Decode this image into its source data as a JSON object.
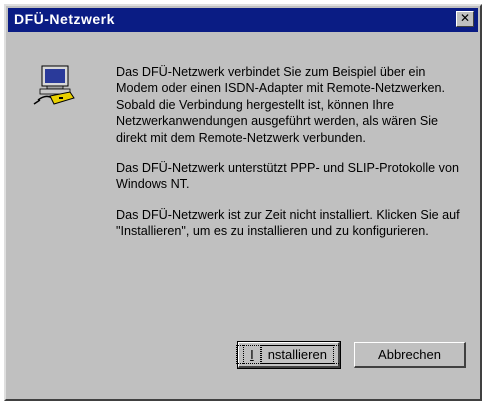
{
  "window": {
    "title": "DFÜ-Netzwerk",
    "close_glyph": "✕"
  },
  "icon": "computer-modem-icon",
  "paragraphs": [
    "Das DFÜ-Netzwerk verbindet Sie zum Beispiel über ein Modem oder einen ISDN-Adapter mit Remote-Netzwerken. Sobald die Verbindung hergestellt ist, können Ihre Netzwerkanwendungen ausgeführt werden, als wären Sie direkt mit dem Remote-Netzwerk verbunden.",
    "Das DFÜ-Netzwerk unterstützt PPP- und SLIP-Protokolle von Windows NT.",
    "Das DFÜ-Netzwerk ist zur Zeit nicht installiert. Klicken Sie auf \"Installieren\", um es zu installieren und zu konfigurieren."
  ],
  "buttons": {
    "install": {
      "mnemonic": "I",
      "rest": "nstallieren"
    },
    "cancel": "Abbrechen"
  },
  "colors": {
    "titlebar": "#0a1c84",
    "face": "#c0c0c0"
  }
}
